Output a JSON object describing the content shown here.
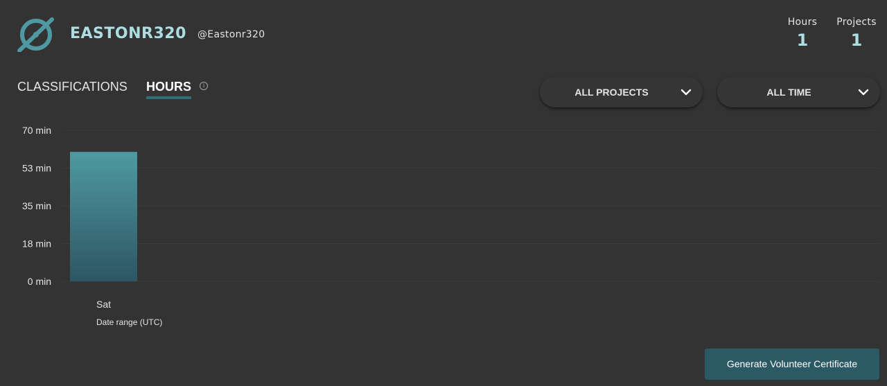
{
  "user": {
    "display_name": "EASTONR320",
    "login": "@Eastonr320"
  },
  "stats": [
    {
      "label": "Hours",
      "value": "1"
    },
    {
      "label": "Projects",
      "value": "1"
    }
  ],
  "tabs": [
    {
      "label": "CLASSIFICATIONS",
      "active": false
    },
    {
      "label": "HOURS",
      "active": true
    }
  ],
  "filters": {
    "projects_label": "ALL PROJECTS",
    "time_label": "ALL TIME"
  },
  "icons": {
    "logo": "zooniverse-logo-icon",
    "info": "info-icon",
    "dropdown": "chevron-down-icon"
  },
  "colors": {
    "accent": "#addde0",
    "bar_top": "#4f9aa2",
    "bar_bottom": "#2d5663",
    "button": "#2b5a64"
  },
  "chart_data": {
    "type": "bar",
    "categories": [
      "Sat"
    ],
    "values": [
      60
    ],
    "y_ticks": [
      "70 min",
      "53 min",
      "35 min",
      "18 min",
      "0 min"
    ],
    "ylim": [
      0,
      70
    ],
    "xlabel": "Date range (UTC)",
    "ylabel": "",
    "grid": true
  },
  "button": {
    "certificate_label": "Generate Volunteer Certificate"
  }
}
